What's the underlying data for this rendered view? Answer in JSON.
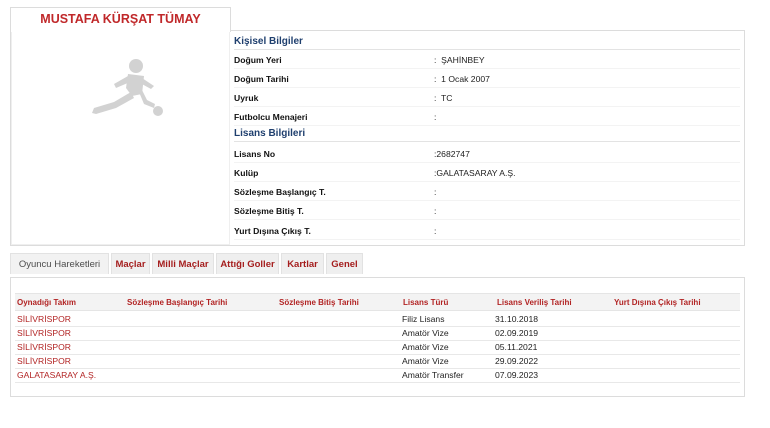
{
  "player": {
    "name": "MUSTAFA KÜRŞAT TÜMAY"
  },
  "personal": {
    "title": "Kişisel Bilgiler",
    "rows": [
      {
        "label": "Doğum Yeri",
        "value": "ŞAHİNBEY"
      },
      {
        "label": "Doğum Tarihi",
        "value": "1 Ocak 2007"
      },
      {
        "label": "Uyruk",
        "value": "TC"
      },
      {
        "label": "Futbolcu Menajeri",
        "value": ""
      }
    ]
  },
  "license": {
    "title": "Lisans Bilgileri",
    "rows": [
      {
        "label": "Lisans No",
        "value": "2682747"
      },
      {
        "label": "Kulüp",
        "value": "GALATASARAY A.Ş."
      },
      {
        "label": "Sözleşme Başlangıç T.",
        "value": ""
      },
      {
        "label": "Sözleşme Bitiş T.",
        "value": ""
      },
      {
        "label": "Yurt Dışına Çıkış T.",
        "value": ""
      }
    ]
  },
  "separator": ":",
  "tabs": [
    "Oyuncu Hareketleri",
    "Maçlar",
    "Milli Maçlar",
    "Attığı Goller",
    "Kartlar",
    "Genel"
  ],
  "table": {
    "headers": [
      "Oynadığı Takım",
      "Sözleşme Başlangıç Tarihi",
      "Sözleşme Bitiş Tarihi",
      "Lisans Türü",
      "Lisans Veriliş Tarihi",
      "Yurt Dışına Çıkış Tarihi"
    ],
    "rows": [
      [
        "SİLİVRİSPOR",
        "",
        "",
        "Filiz Lisans",
        "31.10.2018",
        ""
      ],
      [
        "SİLİVRİSPOR",
        "",
        "",
        "Amatör Vize",
        "02.09.2019",
        ""
      ],
      [
        "SİLİVRİSPOR",
        "",
        "",
        "Amatör Vize",
        "05.11.2021",
        ""
      ],
      [
        "SİLİVRİSPOR",
        "",
        "",
        "Amatör Vize",
        "29.09.2022",
        ""
      ],
      [
        "GALATASARAY A.Ş.",
        "",
        "",
        "Amatör Transfer",
        "07.09.2023",
        ""
      ]
    ]
  },
  "colors": {
    "accent_red": "#c0282a",
    "section_blue": "#1f3f6e"
  },
  "icons": {
    "photo": "player-silhouette-icon"
  }
}
